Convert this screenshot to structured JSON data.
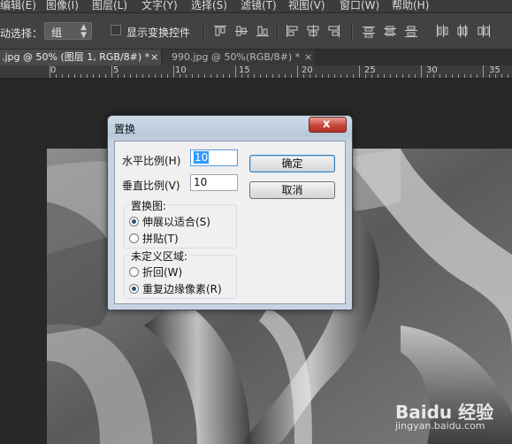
{
  "menubar": {
    "items": [
      "编辑(E)",
      "图像(I)",
      "图层(L)",
      "文字(Y)",
      "选择(S)",
      "滤镜(T)",
      "视图(V)",
      "窗口(W)",
      "帮助(H)"
    ]
  },
  "options": {
    "auto_select_label": "动选择：",
    "auto_select_value": "组",
    "show_transform_label": "显示变换控件"
  },
  "tabs": [
    {
      "label": ".jpg @ 50% (图层 1, RGB/8#) *",
      "close": "×"
    },
    {
      "label": "990.jpg @ 50%(RGB/8#) *",
      "close": "×"
    }
  ],
  "ruler": {
    "numbers": [
      "0",
      "5",
      "10",
      "15",
      "20",
      "25",
      "30",
      "35"
    ]
  },
  "dialog": {
    "title": "置换",
    "close_glyph": "x",
    "horizontal_label": "水平比例(H)",
    "horizontal_value": "10",
    "vertical_label": "垂直比例(V)",
    "vertical_value": "10",
    "ok_label": "确定",
    "cancel_label": "取消",
    "map_group": {
      "title": "置换图:",
      "options": [
        {
          "label": "伸展以适合(S)",
          "checked": true
        },
        {
          "label": "拼贴(T)",
          "checked": false
        }
      ]
    },
    "undefined_group": {
      "title": "未定义区域:",
      "options": [
        {
          "label": "折回(W)",
          "checked": false
        },
        {
          "label": "重复边缘像素(R)",
          "checked": true
        }
      ]
    }
  },
  "watermark": {
    "brand": "Baidu 经验",
    "url": "jingyan.baidu.com"
  },
  "colors": {
    "menubar": "#3c3c3c",
    "options_bar": "#424242",
    "workspace": "#282828",
    "dialog_frame": "#c7d3e0",
    "close_button": "#c7463a"
  }
}
